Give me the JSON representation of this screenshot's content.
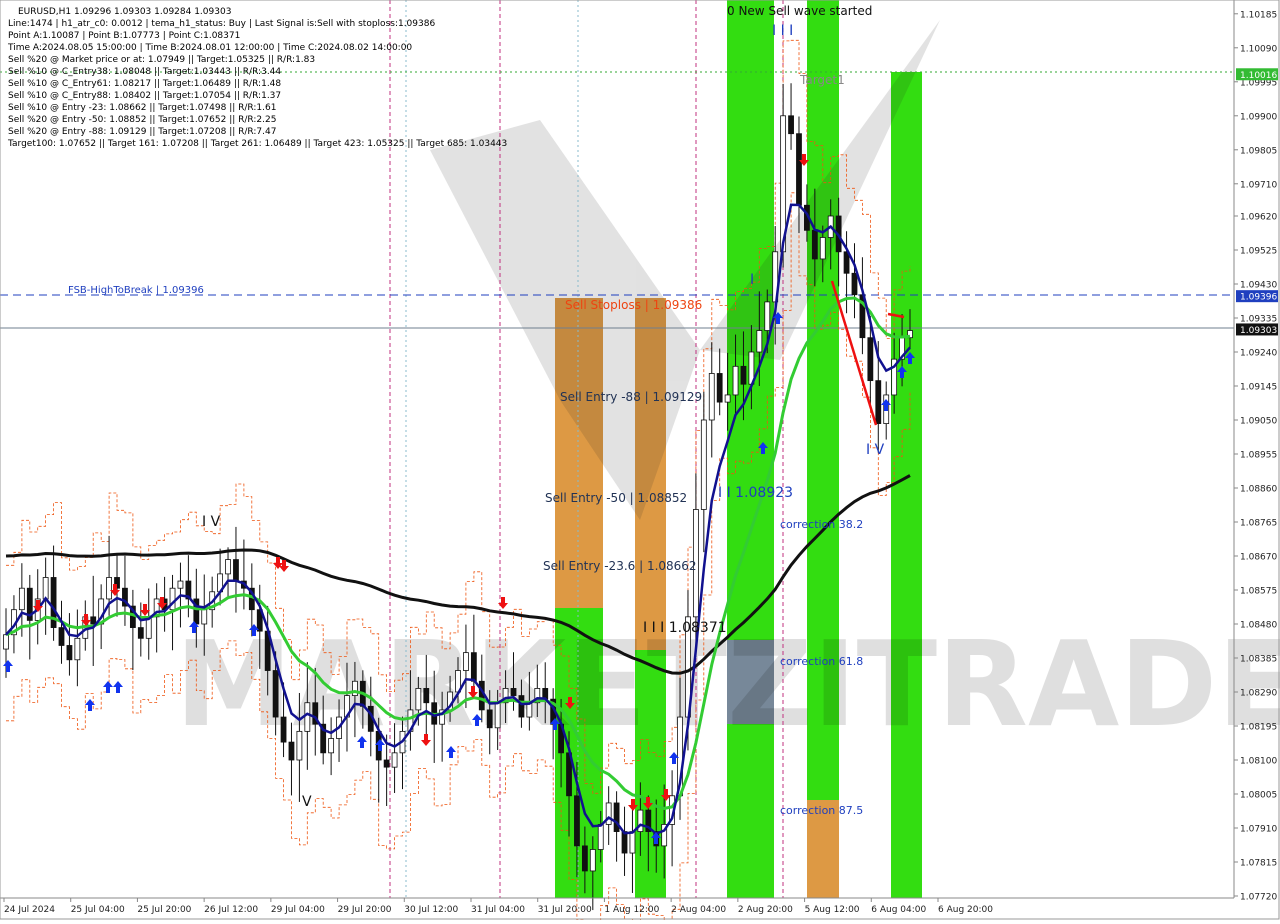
{
  "header": {
    "symbol_line": "EURUSD,H1  1.09296 1.09303 1.09284 1.09303",
    "info_lines": [
      "Line:1474 | h1_atr_c0: 0.0012 | tema_h1_status: Buy | Last Signal is:Sell with stoploss:1.09386",
      "Point A:1.10087 | Point B:1.07773 | Point C:1.08371",
      "Time A:2024.08.05 15:00:00 | Time B:2024.08.01 12:00:00 | Time C:2024.08.02 14:00:00",
      "Sell %20 @ Market price or at: 1.07949 || Target:1.05325 || R/R:1.83",
      "Sell %10 @ C_Entry38: 1.08048 || Target:1.03443 || R/R:3.44",
      "Sell %10 @ C_Entry61: 1.08217 || Target:1.06489 || R/R:1.48",
      "Sell %10 @ C_Entry88: 1.08402 || Target:1.07054 || R/R:1.37",
      "Sell %10 @ Entry -23: 1.08662 || Target:1.07498 || R/R:1.61",
      "Sell %20 @ Entry -50: 1.08852 || Target:1.07652 || R/R:2.25",
      "Sell %20 @ Entry -88: 1.09129 || Target:1.07208 || R/R:7.47",
      "Target100: 1.07652 || Target 161: 1.07208 || Target 261: 1.06489 || Target 423: 1.05325 || Target 685: 1.03443"
    ]
  },
  "annotations": {
    "fsb_label": "FSB-HighToBreak | 1.09396",
    "sell_stoploss": "Sell Stoploss | 1.09386",
    "sell_entry_88": "Sell Entry -88 | 1.09129",
    "sell_entry_50": "Sell Entry -50 | 1.08852",
    "sell_entry_236": "Sell Entry -23.6 | 1.08662",
    "point_c_label": "I I I 1.08371",
    "point_ii_label": "I I 1.08923",
    "new_wave": "0 New Sell wave started",
    "target1": "Target1",
    "correction_382": "correction 38.2",
    "correction_618": "correction 61.8",
    "correction_875": "correction 87.5",
    "wave_iv_left": "I V",
    "wave_v": "V",
    "wave_iii_top": "I I I",
    "wave_i": "I",
    "wave_iv_right": "I V",
    "watermark": "MARKETZITRADE"
  },
  "chart_data": {
    "type": "candlestick",
    "symbol": "EURUSD",
    "timeframe": "H1",
    "ylim": [
      1.0772,
      1.1019
    ],
    "y_ticks": [
      "1.10185",
      "1.10090",
      "1.09995",
      "1.09900",
      "1.09805",
      "1.09710",
      "1.09620",
      "1.09525",
      "1.09430",
      "1.09335",
      "1.09240",
      "1.09145",
      "1.09050",
      "1.08955",
      "1.08860",
      "1.08765",
      "1.08670",
      "1.08575",
      "1.08480",
      "1.08385",
      "1.08290",
      "1.08195",
      "1.08100",
      "1.08005",
      "1.07910",
      "1.07815",
      "1.07720"
    ],
    "x_ticks": [
      "24 Jul 2024",
      "25 Jul 04:00",
      "25 Jul 20:00",
      "26 Jul 12:00",
      "29 Jul 04:00",
      "29 Jul 20:00",
      "30 Jul 12:00",
      "31 Jul 04:00",
      "31 Jul 20:00",
      "1 Aug 12:00",
      "2 Aug 04:00",
      "2 Aug 20:00",
      "5 Aug 12:00",
      "6 Aug 04:00",
      "6 Aug 20:00"
    ],
    "price_badges": [
      {
        "value": "1.10016",
        "color": "#33bb33"
      },
      {
        "value": "1.09396",
        "color": "#1f3fbf"
      },
      {
        "value": "1.09303",
        "color": "#111111"
      }
    ],
    "levels": {
      "target_line": 1.10016,
      "fsb_high_to_break": 1.09396,
      "current_price": 1.09303,
      "sell_stoploss": 1.09386,
      "sell_entry_88": 1.09129,
      "sell_entry_50": 1.08852,
      "sell_entry_236": 1.08662,
      "point_a": 1.10087,
      "point_b": 1.07773,
      "point_c": 1.08371
    },
    "colors": {
      "bull_zone": "#33dd11",
      "bear_zone": "#dd9944",
      "ma_fast": "#11118f",
      "ma_mid": "#33cc33",
      "ma_slow": "#111111",
      "up_arrow": "#1133ee",
      "down_arrow": "#ee1111",
      "target_line": "#33aa33",
      "fsb_line": "#1f3fbf"
    },
    "close_path": [
      1.0845,
      1.0852,
      1.0858,
      1.0849,
      1.0855,
      1.0861,
      1.0847,
      1.0842,
      1.0838,
      1.0844,
      1.085,
      1.0848,
      1.0855,
      1.0861,
      1.0858,
      1.0853,
      1.0847,
      1.0844,
      1.085,
      1.0855,
      1.0852,
      1.0858,
      1.086,
      1.0855,
      1.0848,
      1.0852,
      1.0857,
      1.0862,
      1.0866,
      1.086,
      1.0858,
      1.0852,
      1.0846,
      1.0835,
      1.0822,
      1.0815,
      1.081,
      1.0818,
      1.0826,
      1.082,
      1.0812,
      1.0816,
      1.0822,
      1.0828,
      1.0832,
      1.0825,
      1.0818,
      1.081,
      1.0808,
      1.0812,
      1.0818,
      1.0824,
      1.083,
      1.0826,
      1.082,
      1.0824,
      1.0829,
      1.0835,
      1.084,
      1.0832,
      1.0824,
      1.0819,
      1.0826,
      1.083,
      1.0828,
      1.0822,
      1.0826,
      1.083,
      1.0827,
      1.082,
      1.0812,
      1.08,
      1.0786,
      1.0779,
      1.0785,
      1.0792,
      1.0798,
      1.079,
      1.0784,
      1.079,
      1.0796,
      1.079,
      1.0786,
      1.0792,
      1.08,
      1.0822,
      1.085,
      1.088,
      1.0905,
      1.0918,
      1.091,
      1.0912,
      1.092,
      1.0915,
      1.0924,
      1.093,
      1.0938,
      1.0952,
      1.099,
      1.0985,
      1.0965,
      1.0958,
      1.095,
      1.0956,
      1.0962,
      1.0952,
      1.0946,
      1.094,
      1.0928,
      1.0916,
      1.0904,
      1.0912,
      1.0922,
      1.0928,
      1.093
    ]
  }
}
